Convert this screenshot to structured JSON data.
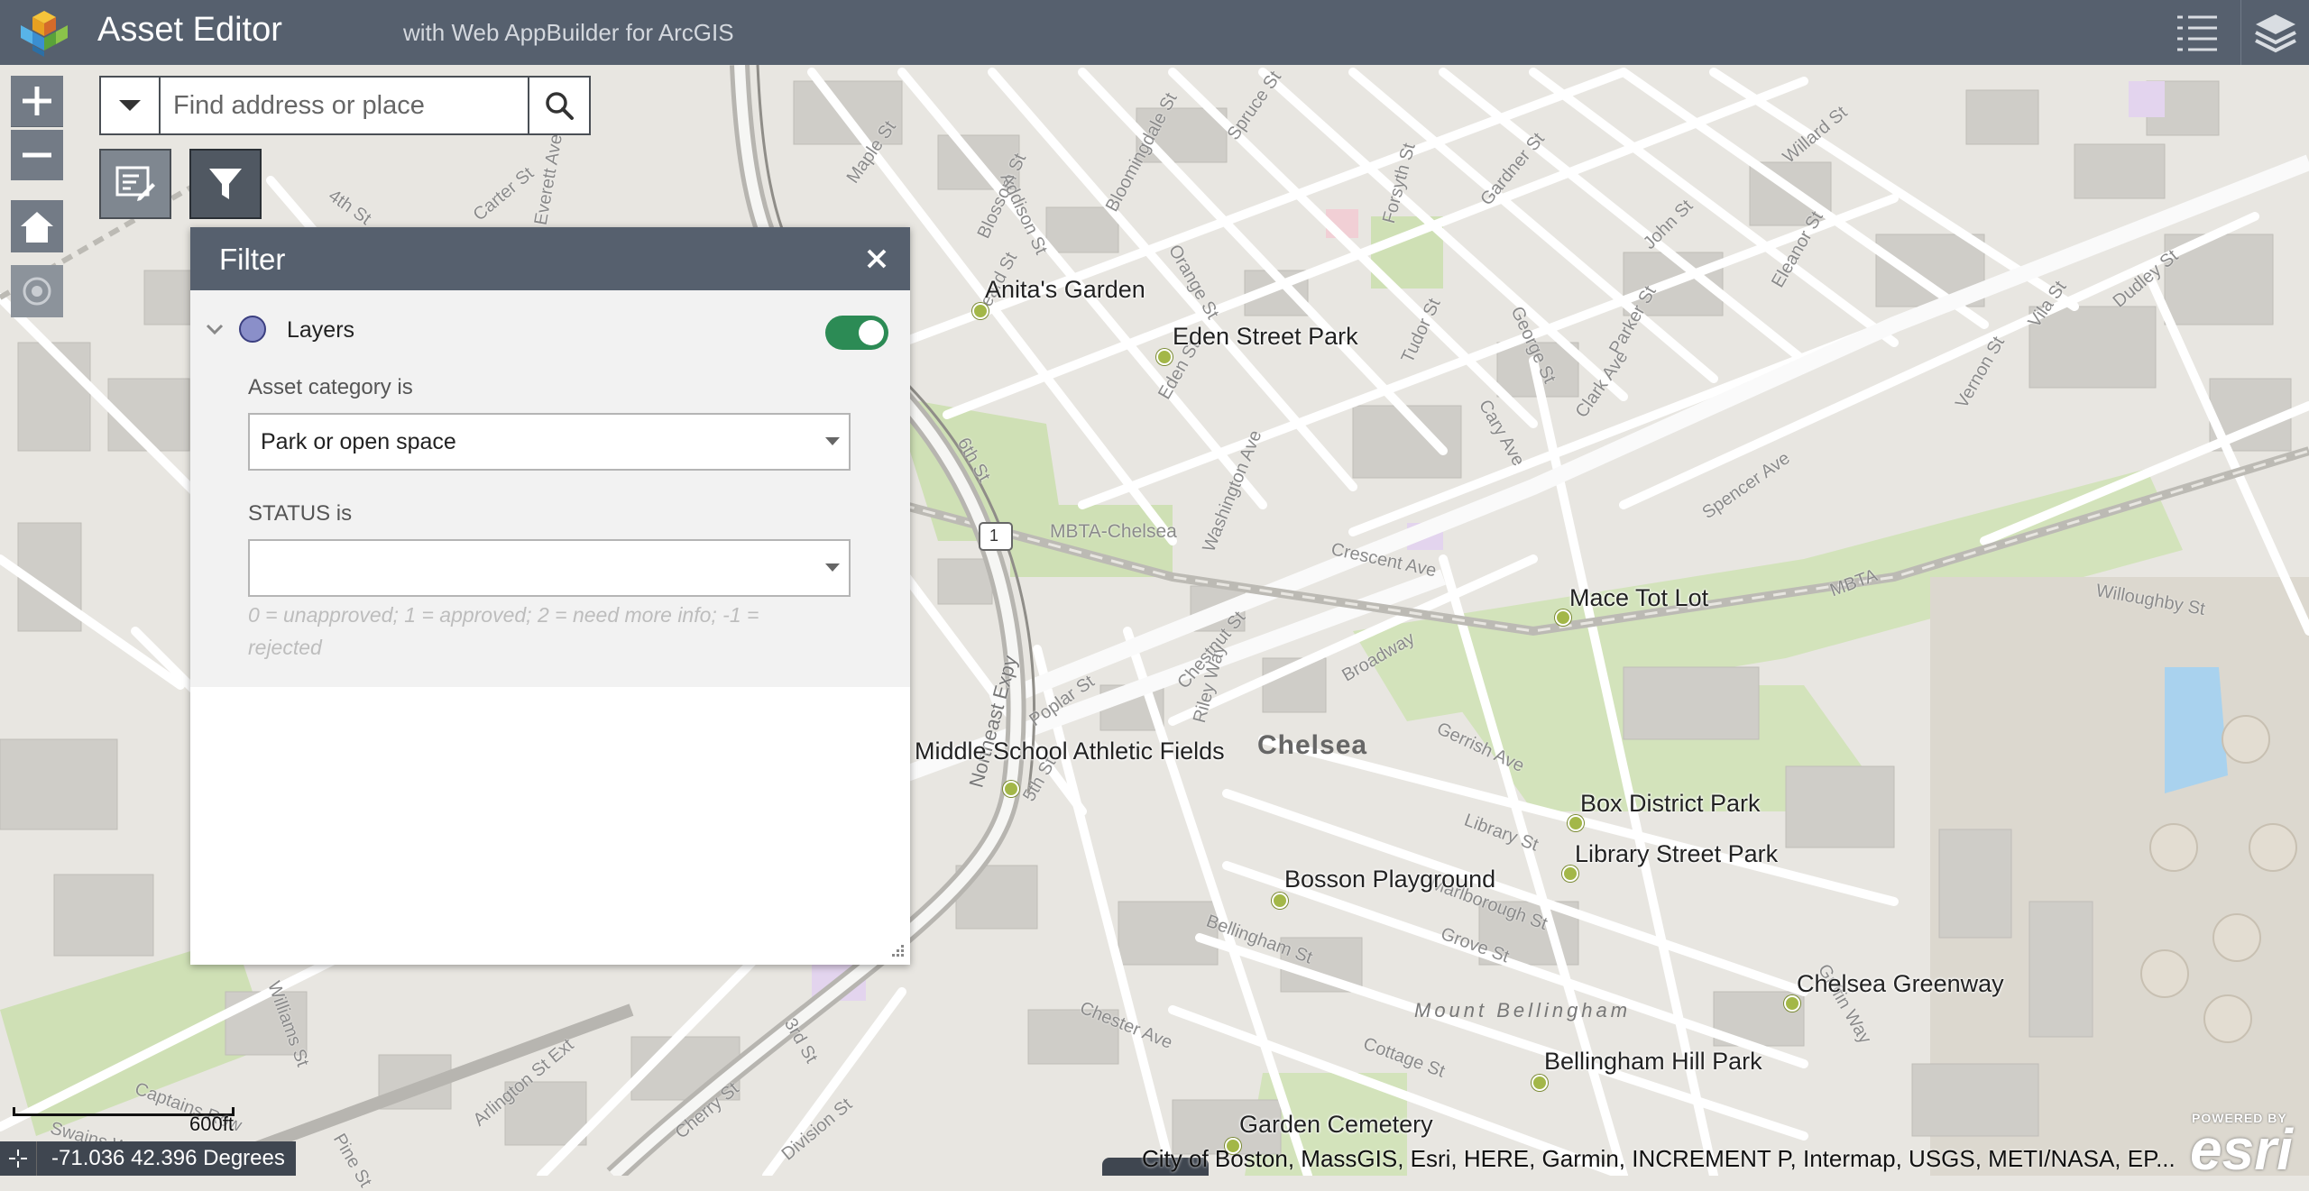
{
  "header": {
    "title": "Asset Editor",
    "subtitle": "with Web AppBuilder for ArcGIS"
  },
  "search": {
    "placeholder": "Find address or place"
  },
  "filter_panel": {
    "title": "Filter",
    "layer_name": "Layers",
    "layer_enabled": true,
    "asset_category_label": "Asset category is",
    "asset_category_value": "Park or open space",
    "status_label": "STATUS is",
    "status_value": "",
    "status_hint": "0 = unapproved; 1 = approved; 2 = need more info; -1 = rejected"
  },
  "map": {
    "places": [
      {
        "name": "Anita's Garden"
      },
      {
        "name": "Eden Street Park"
      },
      {
        "name": "Mace Tot Lot"
      },
      {
        "name": "Middle School Athletic Fields"
      },
      {
        "name": "Box District Park"
      },
      {
        "name": "Library Street Park"
      },
      {
        "name": "Bosson Playground"
      },
      {
        "name": "Chelsea Greenway"
      },
      {
        "name": "Bellingham Hill Park"
      },
      {
        "name": "Garden Cemetery"
      }
    ],
    "area_label": "Chelsea",
    "neighborhood_label": "Mount Bellingham",
    "transit_label": "MBTA-Chelsea",
    "rail_label": "MBTA",
    "highway_label": "Northeast Expy",
    "route_shield": "1",
    "streets": {
      "maple": "Maple St",
      "addison": "Addison St",
      "blossom": "Blossom St",
      "heard": "Heard St",
      "orange": "Orange St",
      "bloomingdale": "Bloomingdale St",
      "spruce": "Spruce St",
      "forsyth": "Forsyth St",
      "gardner": "Gardner St",
      "willard": "Willard St",
      "john": "John St",
      "eleanor": "Eleanor St",
      "dudley": "Dudley St",
      "vila": "Vila St",
      "vernon": "Vernon St",
      "parker": "Parker St",
      "george": "George St",
      "clark": "Clark Ave",
      "cary": "Cary Ave",
      "tudor": "Tudor St",
      "eden": "Eden St",
      "washington": "Washington Ave",
      "spencer": "Spencer Ave",
      "crescent": "Crescent Ave",
      "willoughby": "Willoughby St",
      "chestnut": "Chestnut St",
      "riley": "Riley Way",
      "broadway": "Broadway",
      "poplar": "Poplar St",
      "sixth": "6th St",
      "fifth": "5th St",
      "gerrish": "Gerrish Ave",
      "library": "Library St",
      "marlborough": "Marlborough St",
      "grove": "Grove St",
      "bellingham": "Bellingham St",
      "chester": "Chester Ave",
      "cottage": "Cottage St",
      "carter": "Carter St",
      "everett": "Everett Ave",
      "fourth": "4th St",
      "third": "3rd St",
      "arlington": "Arlington St Ext",
      "cherry": "Cherry St",
      "division": "Division St",
      "williams": "Williams St",
      "pine": "Pine St",
      "captains": "Captains Row",
      "swains": "Swains Way",
      "griffin": "Griffin Way"
    }
  },
  "scalebar": {
    "label": "600ft"
  },
  "coordinates": {
    "text": "-71.036 42.396 Degrees"
  },
  "attribution": {
    "text": "City of Boston, MassGIS, Esri, HERE, Garmin, INCREMENT P, Intermap, USGS, METI/NASA, EP..."
  },
  "esri": {
    "powered": "POWERED BY",
    "word": "esri"
  },
  "colors": {
    "header": "#56606e",
    "toggle_on": "#2c8b55",
    "place_dot": "#a3b748",
    "layer_swatch": "#8a8fc9"
  }
}
